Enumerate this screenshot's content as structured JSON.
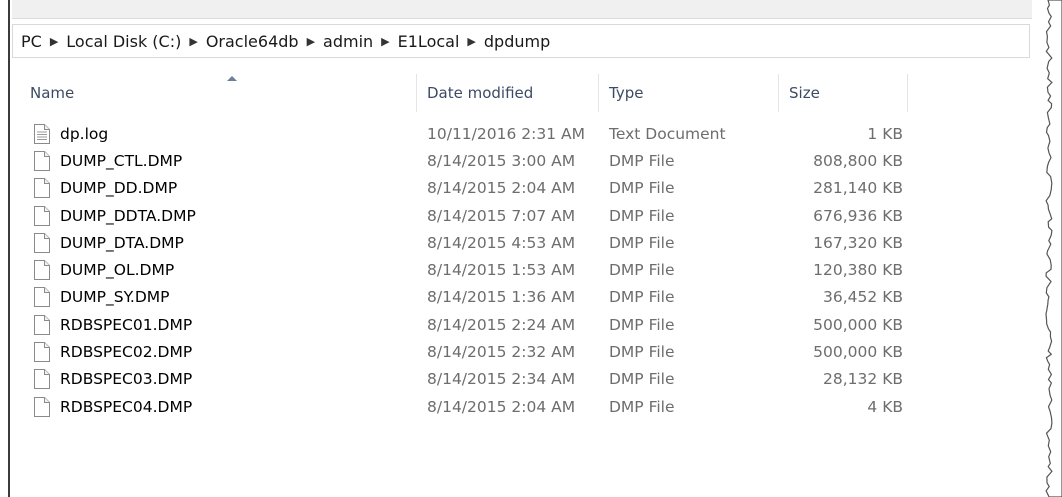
{
  "breadcrumb": [
    "PC",
    "Local Disk (C:)",
    "Oracle64db",
    "admin",
    "E1Local",
    "dpdump"
  ],
  "columns": {
    "name": "Name",
    "date_modified": "Date modified",
    "type": "Type",
    "size": "Size"
  },
  "sort": {
    "column": "name",
    "direction": "ascending"
  },
  "files": [
    {
      "name": "dp.log",
      "date": "10/11/2016 2:31 AM",
      "type": "Text Document",
      "size": "1 KB",
      "icon": "text-document-icon"
    },
    {
      "name": "DUMP_CTL.DMP",
      "date": "8/14/2015 3:00 AM",
      "type": "DMP File",
      "size": "808,800 KB",
      "icon": "file-icon"
    },
    {
      "name": "DUMP_DD.DMP",
      "date": "8/14/2015 2:04 AM",
      "type": "DMP File",
      "size": "281,140 KB",
      "icon": "file-icon"
    },
    {
      "name": "DUMP_DDTA.DMP",
      "date": "8/14/2015 7:07 AM",
      "type": "DMP File",
      "size": "676,936 KB",
      "icon": "file-icon"
    },
    {
      "name": "DUMP_DTA.DMP",
      "date": "8/14/2015 4:53 AM",
      "type": "DMP File",
      "size": "167,320 KB",
      "icon": "file-icon"
    },
    {
      "name": "DUMP_OL.DMP",
      "date": "8/14/2015 1:53 AM",
      "type": "DMP File",
      "size": "120,380 KB",
      "icon": "file-icon"
    },
    {
      "name": "DUMP_SY.DMP",
      "date": "8/14/2015 1:36 AM",
      "type": "DMP File",
      "size": "36,452 KB",
      "icon": "file-icon"
    },
    {
      "name": "RDBSPEC01.DMP",
      "date": "8/14/2015 2:24 AM",
      "type": "DMP File",
      "size": "500,000 KB",
      "icon": "file-icon"
    },
    {
      "name": "RDBSPEC02.DMP",
      "date": "8/14/2015 2:32 AM",
      "type": "DMP File",
      "size": "500,000 KB",
      "icon": "file-icon"
    },
    {
      "name": "RDBSPEC03.DMP",
      "date": "8/14/2015 2:34 AM",
      "type": "DMP File",
      "size": "28,132 KB",
      "icon": "file-icon"
    },
    {
      "name": "RDBSPEC04.DMP",
      "date": "8/14/2015 2:04 AM",
      "type": "DMP File",
      "size": "4 KB",
      "icon": "file-icon"
    }
  ]
}
